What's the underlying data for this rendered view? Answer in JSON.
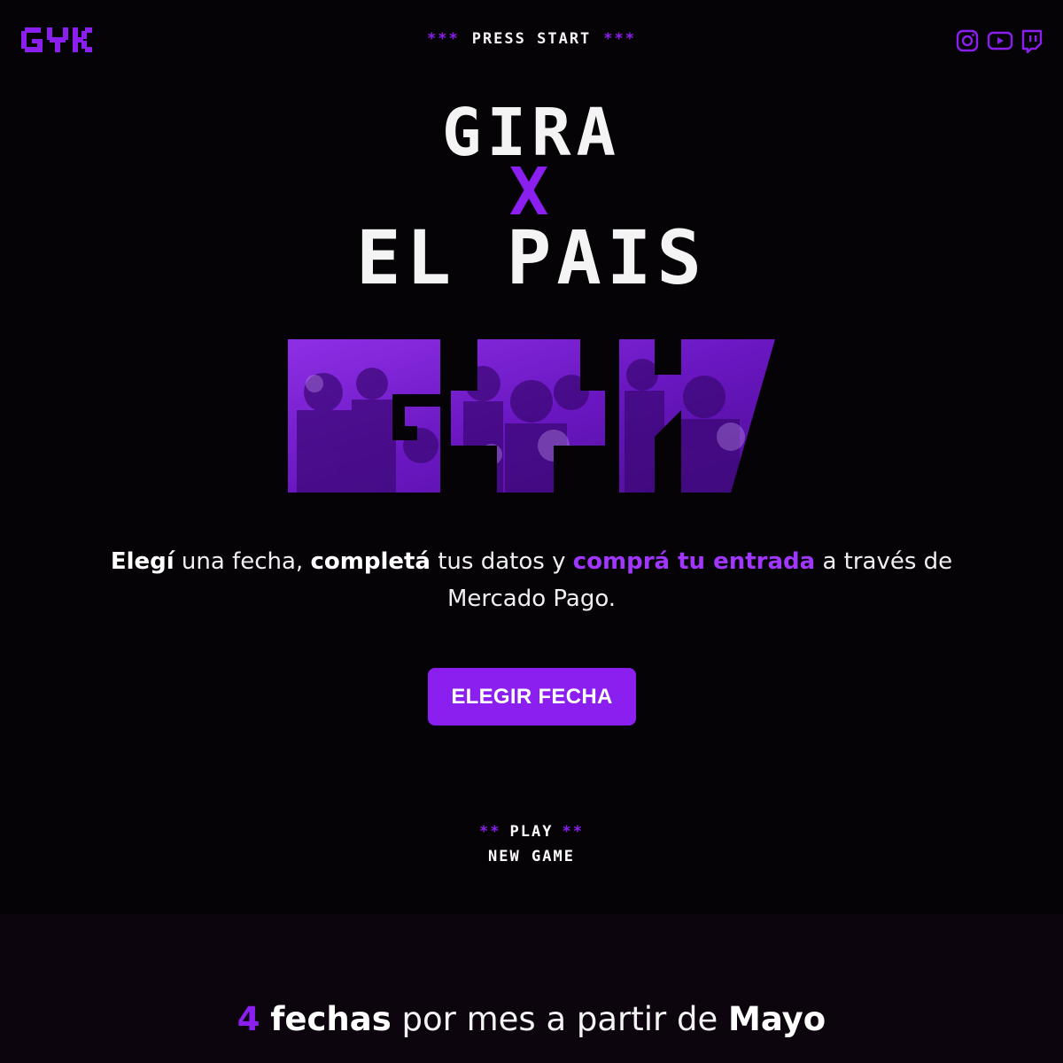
{
  "header": {
    "logo_text": "GYK",
    "press_start": {
      "stars_left": "***",
      "label": "PRESS START",
      "stars_right": "***"
    },
    "socials": [
      "instagram-icon",
      "youtube-icon",
      "twitch-icon"
    ]
  },
  "hero": {
    "line1": "GIRA",
    "line2": "X",
    "line3": "EL PAIS",
    "photo_word": "GYK"
  },
  "intro": {
    "part1": "Elegí",
    "part2": " una fecha, ",
    "part3": "completá",
    "part4": " tus datos y ",
    "part5": "comprá tu entrada",
    "part6": " a través de Mercado Pago."
  },
  "cta": {
    "label": "ELEGIR FECHA"
  },
  "play_menu": {
    "stars_left": "**",
    "play_label": "PLAY",
    "stars_right": "**",
    "new_game": "NEW GAME"
  },
  "dates": {
    "number": "4",
    "word": "fechas",
    "middle": " por mes a partir de ",
    "month": "Mayo"
  },
  "colors": {
    "accent": "#8a1ff0",
    "accent_text": "#a137ff",
    "background": "#060307",
    "text": "#ffffff"
  }
}
